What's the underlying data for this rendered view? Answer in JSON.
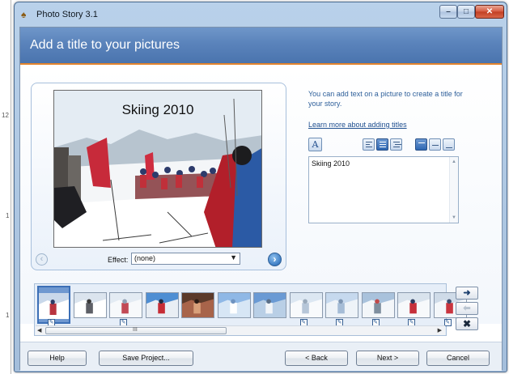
{
  "window": {
    "title": "Photo Story 3.1"
  },
  "header": {
    "title": "Add a title to your pictures"
  },
  "preview": {
    "overlay_title": "Skiing 2010",
    "effect_label": "Effect:",
    "effect_value": "(none)"
  },
  "sidebar": {
    "info_text": "You can add text on a picture to create a title for your story.",
    "learn_link": "Learn more about adding titles",
    "text_value": "Skiing 2010"
  },
  "filmstrip": {
    "selected_index": 0,
    "grip": "III",
    "thumbnails": [
      {
        "scene": "ski-group",
        "has_title": true
      },
      {
        "scene": "ski-lift",
        "has_title": false
      },
      {
        "scene": "skiers-snow",
        "has_title": true
      },
      {
        "scene": "skier-closeup",
        "has_title": false
      },
      {
        "scene": "people-indoor",
        "has_title": false
      },
      {
        "scene": "snow-sky",
        "has_title": false
      },
      {
        "scene": "mountain-view",
        "has_title": false
      },
      {
        "scene": "white-slope",
        "has_title": true
      },
      {
        "scene": "pale-mountain",
        "has_title": true
      },
      {
        "scene": "snowy-valley",
        "has_title": true
      },
      {
        "scene": "skier-red",
        "has_title": true
      },
      {
        "scene": "skier-edge",
        "has_title": true
      }
    ]
  },
  "buttons": {
    "help": "Help",
    "save": "Save Project...",
    "back": "< Back",
    "next": "Next >",
    "cancel": "Cancel"
  },
  "background": {
    "margin_labels": [
      "12",
      "1",
      "1"
    ]
  },
  "colors": {
    "header_blue": "#5a83bb",
    "accent_orange": "#e3842c",
    "link_blue": "#1d4e8f",
    "close_red": "#c13d22"
  }
}
